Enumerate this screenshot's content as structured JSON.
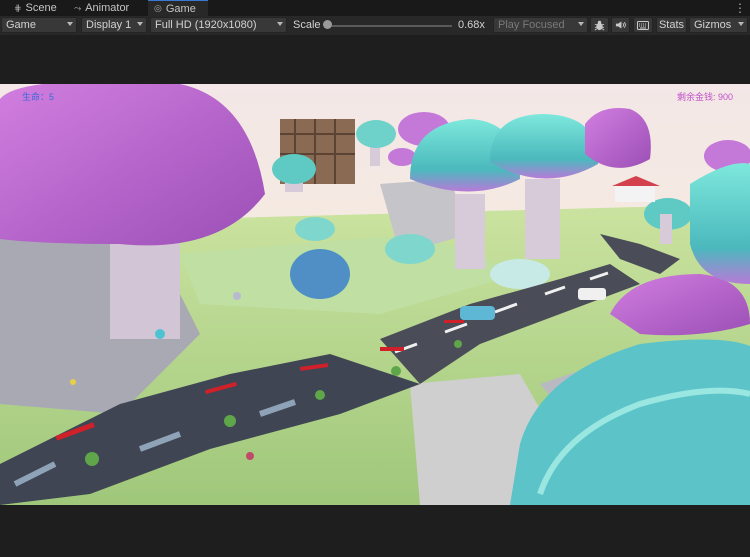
{
  "tabs": [
    {
      "label": "Scene",
      "icon": "grid-icon"
    },
    {
      "label": "Animator",
      "icon": "animator-icon"
    },
    {
      "label": "Game",
      "icon": "gamepad-icon",
      "active": true
    }
  ],
  "toolbar": {
    "view_select": "Game",
    "display_select": "Display 1",
    "resolution_select": "Full HD (1920x1080)",
    "scale_label": "Scale",
    "scale_value": "0.68x",
    "scale_fraction": 0.02,
    "play_focused_select": "Play Focused",
    "stats_label": "Stats",
    "gizmos_label": "Gizmos"
  },
  "hud": {
    "left_text": "生命：5",
    "money_text": "剩余金钱: 900"
  },
  "colors": {
    "accent": "#3a79d3",
    "hud_blue": "#3a6ad8",
    "hud_magenta": "#c050c8"
  }
}
